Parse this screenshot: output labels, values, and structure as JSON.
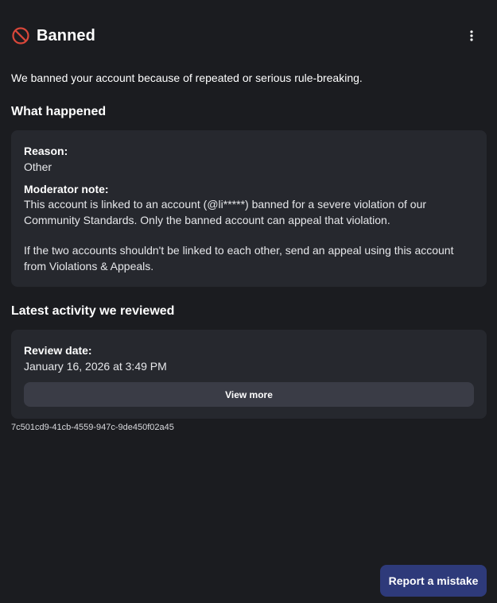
{
  "header": {
    "title": "Banned",
    "ban_icon": "no-entry-icon",
    "more_icon": "more-vertical-icon"
  },
  "intro": "We banned your account because of repeated or serious rule-breaking.",
  "what_happened": {
    "title": "What happened",
    "reason_label": "Reason:",
    "reason_value": "Other",
    "note_label": "Moderator note:",
    "note_paragraph_1": "This account is linked to an account (@li*****) banned for a severe violation of our Community Standards. Only the banned account can appeal that violation.",
    "note_paragraph_2": "If the two accounts shouldn't be linked to each other, send an appeal using this account from Violations & Appeals."
  },
  "latest_activity": {
    "title": "Latest activity we reviewed",
    "review_date_label": "Review date:",
    "review_date_value": "January 16, 2026 at 3:49 PM",
    "view_more_label": "View more"
  },
  "case_id": "7c501cd9-41cb-4559-947c-9de450f02a45",
  "footer": {
    "report_label": "Report a mistake"
  },
  "colors": {
    "background": "#1b1c20",
    "card": "#26282e",
    "button": "#3a3c46",
    "primary": "#2e3a7a",
    "ban_red": "#d9473a"
  }
}
